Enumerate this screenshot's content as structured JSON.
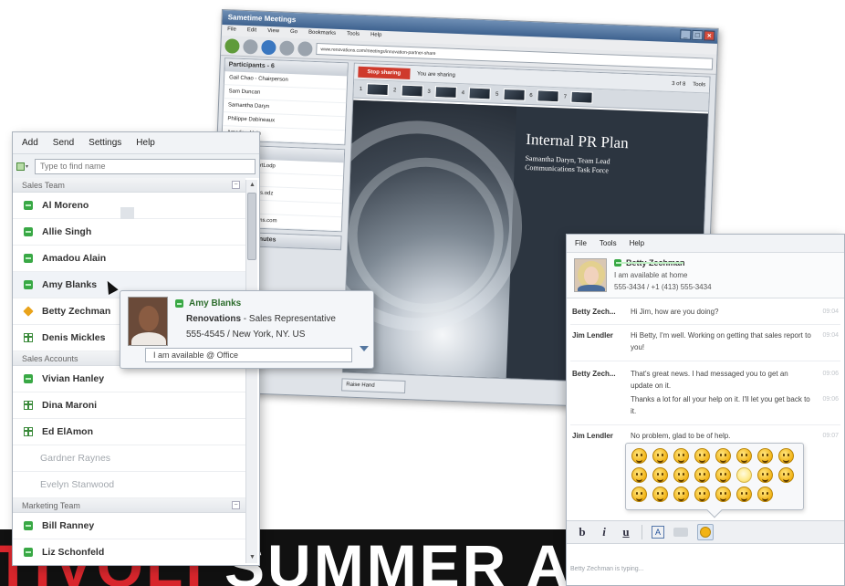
{
  "meetings": {
    "title": "Sametime Meetings",
    "menu": [
      "File",
      "Edit",
      "View",
      "Go",
      "Bookmarks",
      "Tools",
      "Help"
    ],
    "url": "www.renovations.com/meetings/innovation-partner-share",
    "participants_header": "Participants - 6",
    "participants": [
      "Gail Chao - Chairperson",
      "Sam Duncan",
      "Samantha Daryn",
      "Philippe Dabineaux",
      "Amadou Alain"
    ],
    "files_header": "",
    "files": [
      "rnational_ChartLodp",
      "Download",
      "aness@ngrules.odz",
      "rsonwen.odp",
      "www.renovations.com"
    ],
    "minutes_header": "Ision and Minutes",
    "stop_label": "Stop sharing",
    "sharing_label": "You are sharing",
    "page_label": "3 of 8",
    "tools_label": "Tools",
    "thumbs": [
      "1",
      "2",
      "3",
      "4",
      "5",
      "6",
      "7"
    ],
    "slide_title": "Internal PR Plan",
    "slide_subtitle_1": "Samantha Daryn, Team Lead",
    "slide_subtitle_2": "Communications Task Force",
    "raise_hand": "Raise Hand"
  },
  "contacts": {
    "menu": [
      "Add",
      "Send",
      "Settings",
      "Help"
    ],
    "search_placeholder": "Type to find name",
    "groups": [
      {
        "name": "Sales Team",
        "contacts": [
          {
            "name": "Al Moreno",
            "status": "available"
          },
          {
            "name": "Allie Singh",
            "status": "available"
          },
          {
            "name": "Amadou Alain",
            "status": "available"
          },
          {
            "name": "Amy Blanks",
            "status": "available"
          },
          {
            "name": "Betty Zechman",
            "status": "away"
          },
          {
            "name": "Denis Mickles",
            "status": "meeting"
          }
        ]
      },
      {
        "name": "Sales Accounts",
        "contacts": [
          {
            "name": "Vivian Hanley",
            "status": "available"
          },
          {
            "name": "Dina Maroni",
            "status": "meeting"
          },
          {
            "name": "Ed ElAmon",
            "status": "meeting"
          },
          {
            "name": "Gardner Raynes",
            "status": "offline"
          },
          {
            "name": "Evelyn Stanwood",
            "status": "offline"
          }
        ]
      },
      {
        "name": "Marketing Team",
        "contacts": [
          {
            "name": "Bill Ranney",
            "status": "available"
          },
          {
            "name": "Liz Schonfeld",
            "status": "available"
          }
        ]
      }
    ]
  },
  "bizcard": {
    "name": "Amy Blanks",
    "company": "Renovations",
    "title": " - Sales Representative",
    "phone": "555-4545 / New York, NY. US",
    "status": "I am available @ Office"
  },
  "chat": {
    "menu": [
      "File",
      "Tools",
      "Help"
    ],
    "partner_name": "Betty Zechman",
    "partner_status": "I am available at home",
    "partner_phone": "555-3434 / +1 (413) 555-3434",
    "messages": [
      {
        "who": "Betty Zech...",
        "text": "Hi Jim, how are you doing?",
        "time": "09:04"
      },
      {
        "who": "Jim Lendler",
        "text": "Hi Betty, I'm well.  Working on getting that sales report to you!",
        "time": "09:04"
      },
      {
        "who": "Betty Zech...",
        "text": "That's great news. I had messaged you to get an update on it.",
        "time": "09:06"
      },
      {
        "who": "",
        "text": "Thanks a lot for all your help on it. I'll let you get back to it.",
        "time": "09:06"
      },
      {
        "who": "Jim Lendler",
        "text": "No problem, glad to be of help.",
        "time": "09:07"
      }
    ],
    "emoticon_count": 23,
    "toolbar": [
      "b",
      "i",
      "u"
    ],
    "typing": "Betty Zechman is typing..."
  },
  "banner": {
    "red": "TIVOLI",
    "white": " SUMMER ACADEMY"
  }
}
